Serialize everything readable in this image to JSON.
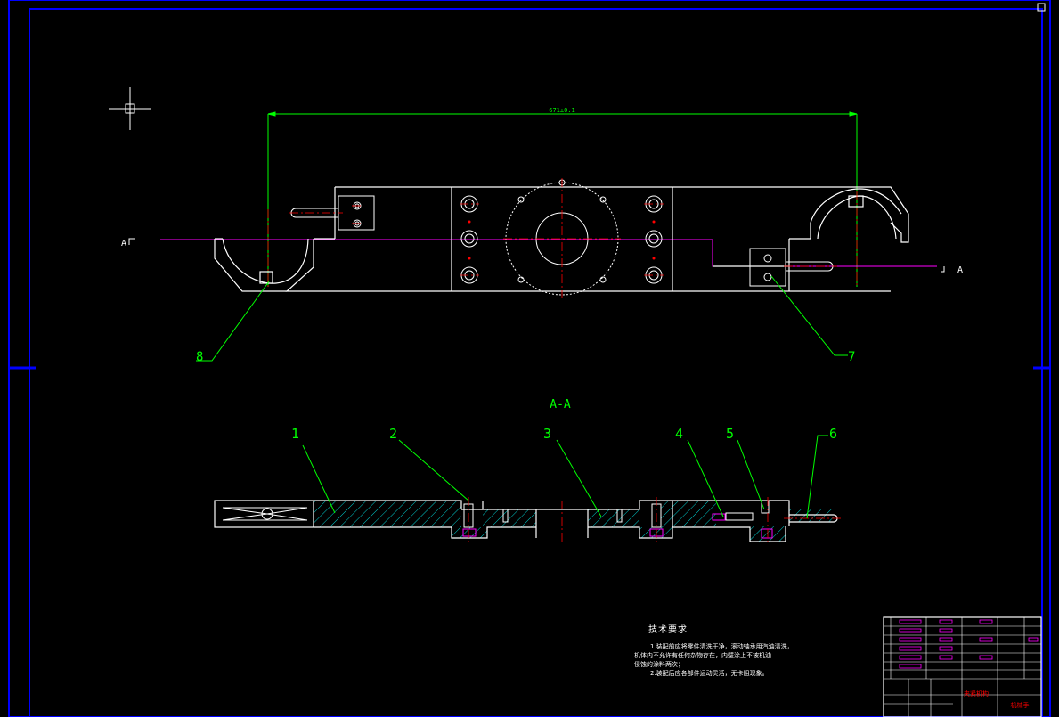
{
  "drawing": {
    "dimension_label": "671±0.1",
    "section_title": "A-A",
    "section_marker_left": "A",
    "section_marker_right": "A",
    "balloons": [
      "1",
      "2",
      "3",
      "4",
      "5",
      "6",
      "7",
      "8"
    ]
  },
  "tech_requirements": {
    "heading": "技术要求",
    "line1": "1.装配前应将零件清洗干净，滚动轴承用汽油清洗，",
    "line2": "机体内不允许有任何杂物存在，内壁涂上不被机油",
    "line3": "侵蚀的涂料两次；",
    "line4": "2.装配后应各部件运动灵活，无卡阻现象。"
  },
  "title_block": {
    "cell_left": "夹紧机构",
    "cell_right": "机械手"
  },
  "colors": {
    "background": "#000000",
    "frame": "#0000ff",
    "outline": "#ffffff",
    "leader": "#00ff00",
    "section_line": "#ff00ff",
    "center_line": "#ff0000",
    "hatch": "#00ffff"
  }
}
